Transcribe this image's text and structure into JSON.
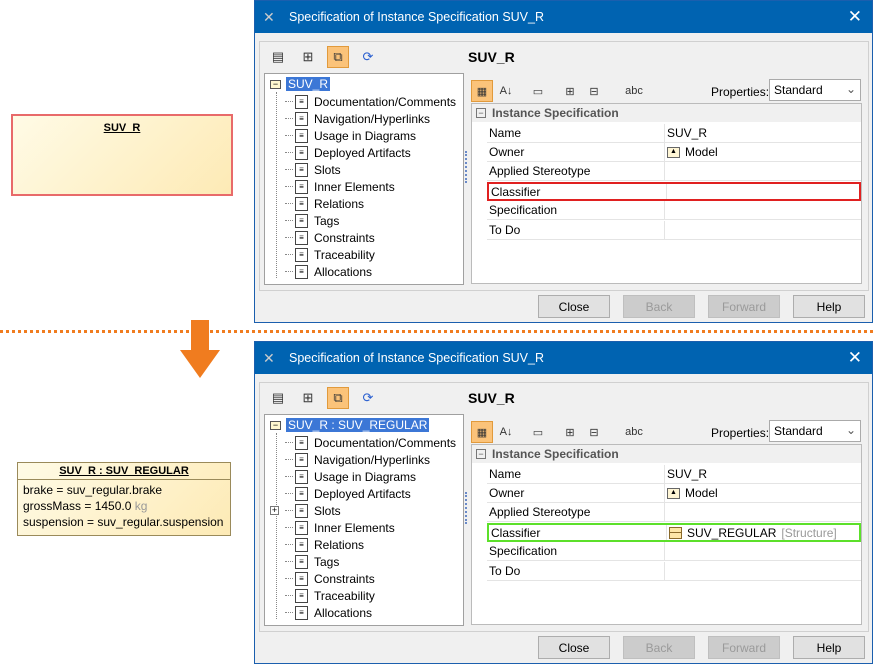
{
  "diagram_top": {
    "name": "SUV_R"
  },
  "diagram_bottom": {
    "name": "SUV_R : SUV_REGULAR",
    "slots": [
      "brake = suv_regular.brake",
      "grossMass = 1450.0",
      "suspension = suv_regular.suspension"
    ],
    "unit": "kg"
  },
  "dialogs": [
    {
      "title": "Specification of Instance Specification SUV_R",
      "header": "SUV_R",
      "root": "SUV_R",
      "slots_expandable": false,
      "tree": [
        "Documentation/Comments",
        "Navigation/Hyperlinks",
        "Usage in Diagrams",
        "Deployed Artifacts",
        "Slots",
        "Inner Elements",
        "Relations",
        "Tags",
        "Constraints",
        "Traceability",
        "Allocations"
      ],
      "properties_label": "Properties:",
      "properties_value": "Standard",
      "group": "Instance Specification",
      "rows": [
        {
          "k": "Name",
          "v": "SUV_R"
        },
        {
          "k": "Owner",
          "v": "Model"
        },
        {
          "k": "Applied Stereotype",
          "v": ""
        },
        {
          "k": "Classifier",
          "v": "",
          "extra": ""
        },
        {
          "k": "Specification",
          "v": ""
        },
        {
          "k": "To Do",
          "v": ""
        }
      ],
      "highlight": "#e02020",
      "buttons": [
        "Close",
        "Back",
        "Forward",
        "Help"
      ]
    },
    {
      "title": "Specification of Instance Specification SUV_R",
      "header": "SUV_R",
      "root": "SUV_R : SUV_REGULAR",
      "slots_expandable": true,
      "tree": [
        "Documentation/Comments",
        "Navigation/Hyperlinks",
        "Usage in Diagrams",
        "Deployed Artifacts",
        "Slots",
        "Inner Elements",
        "Relations",
        "Tags",
        "Constraints",
        "Traceability",
        "Allocations"
      ],
      "properties_label": "Properties:",
      "properties_value": "Standard",
      "group": "Instance Specification",
      "rows": [
        {
          "k": "Name",
          "v": "SUV_R"
        },
        {
          "k": "Owner",
          "v": "Model"
        },
        {
          "k": "Applied Stereotype",
          "v": ""
        },
        {
          "k": "Classifier",
          "v": "SUV_REGULAR",
          "extra": "[Structure]"
        },
        {
          "k": "Specification",
          "v": ""
        },
        {
          "k": "To Do",
          "v": ""
        }
      ],
      "highlight": "#5ce02a",
      "buttons": [
        "Close",
        "Back",
        "Forward",
        "Help"
      ]
    }
  ]
}
